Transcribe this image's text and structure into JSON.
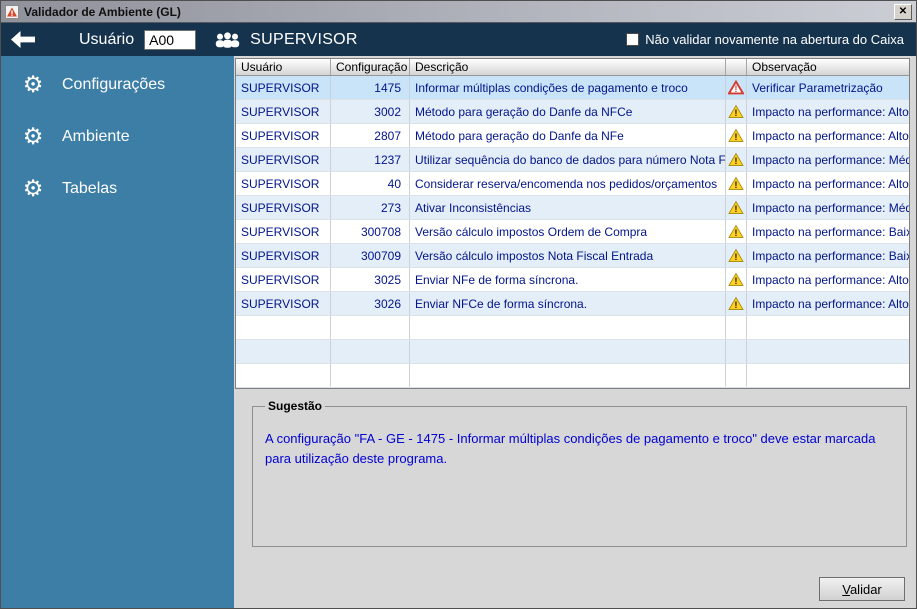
{
  "window": {
    "title": "Validador de Ambiente (GL)",
    "close_glyph": "✕"
  },
  "header": {
    "user_label": "Usuário",
    "user_value": "A00",
    "user_name": "SUPERVISOR",
    "checkbox_label": "Não validar novamente na abertura do Caixa",
    "checkbox_checked": false
  },
  "sidebar": {
    "gear_glyph": "⚙",
    "items": [
      {
        "label": "Configurações",
        "icon": "gear"
      },
      {
        "label": "Ambiente",
        "icon": "gear"
      },
      {
        "label": "Tabelas",
        "icon": "gear"
      }
    ]
  },
  "table": {
    "columns": [
      "Usuário",
      "Configuração",
      "Descrição",
      "",
      "Observação"
    ],
    "rows": [
      {
        "usuario": "SUPERVISOR",
        "configuracao": "1475",
        "descricao": "Informar múltiplas condições de pagamento e troco",
        "icon": "red-warning",
        "observacao": "Verificar Parametrização",
        "selected": true
      },
      {
        "usuario": "SUPERVISOR",
        "configuracao": "3002",
        "descricao": "Método para geração do Danfe da NFCe",
        "icon": "yellow-warning",
        "observacao": "Impacto na performance: Alto",
        "selected": false
      },
      {
        "usuario": "SUPERVISOR",
        "configuracao": "2807",
        "descricao": "Método para geração do Danfe da NFe",
        "icon": "yellow-warning",
        "observacao": "Impacto na performance: Alto",
        "selected": false
      },
      {
        "usuario": "SUPERVISOR",
        "configuracao": "1237",
        "descricao": "Utilizar sequência do banco de dados para número Nota Fiscal",
        "icon": "yellow-warning",
        "observacao": "Impacto na performance: Médio",
        "selected": false
      },
      {
        "usuario": "SUPERVISOR",
        "configuracao": "40",
        "descricao": "Considerar reserva/encomenda nos pedidos/orçamentos",
        "icon": "yellow-warning",
        "observacao": "Impacto na performance: Alto",
        "selected": false
      },
      {
        "usuario": "SUPERVISOR",
        "configuracao": "273",
        "descricao": "Ativar Inconsistências",
        "icon": "yellow-warning",
        "observacao": "Impacto na performance: Médio",
        "selected": false
      },
      {
        "usuario": "SUPERVISOR",
        "configuracao": "300708",
        "descricao": "Versão cálculo impostos Ordem de Compra",
        "icon": "yellow-warning",
        "observacao": "Impacto na performance: Baixo",
        "selected": false
      },
      {
        "usuario": "SUPERVISOR",
        "configuracao": "300709",
        "descricao": "Versão cálculo impostos Nota Fiscal Entrada",
        "icon": "yellow-warning",
        "observacao": "Impacto na performance: Baixo",
        "selected": false
      },
      {
        "usuario": "SUPERVISOR",
        "configuracao": "3025",
        "descricao": "Enviar NFe de forma síncrona.",
        "icon": "yellow-warning",
        "observacao": "Impacto na performance: Alto",
        "selected": false
      },
      {
        "usuario": "SUPERVISOR",
        "configuracao": "3026",
        "descricao": "Enviar NFCe de forma síncrona.",
        "icon": "yellow-warning",
        "observacao": "Impacto na performance: Alto",
        "selected": false
      }
    ],
    "empty_rows": 3
  },
  "suggestion": {
    "title": "Sugestão",
    "text": "A configuração \"FA - GE - 1475 - Informar múltiplas condições de pagamento e troco\" deve estar marcada para utilização deste programa."
  },
  "footer": {
    "validate_label": "Validar",
    "validate_label_first": "V",
    "validate_label_rest": "alidar"
  },
  "colors": {
    "header_bg": "#16334e",
    "sidebar_bg": "#3d7ea6",
    "selected_row": "#c9e3f8",
    "warning_red": "#d53a2f",
    "warning_yellow": "#ffcf21",
    "suggestion_text": "#0000d4",
    "table_text": "#001489"
  }
}
